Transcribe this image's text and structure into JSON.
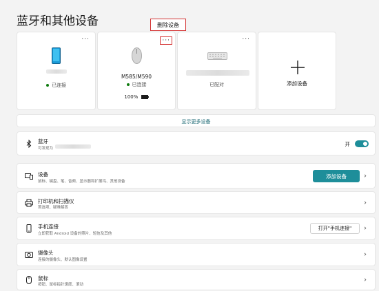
{
  "page": {
    "title": "蓝牙和其他设备"
  },
  "tooltip": {
    "label": "删除设备"
  },
  "cards": [
    {
      "name": "",
      "status": "已连接",
      "battery": ""
    },
    {
      "name": "M585/M590",
      "status": "已连接",
      "battery": "100%"
    },
    {
      "name": "",
      "status": "已配对",
      "battery": ""
    },
    {
      "name": "添加设备",
      "status": "",
      "battery": ""
    }
  ],
  "show_more": {
    "label": "显示更多设备"
  },
  "bluetooth": {
    "title": "蓝牙",
    "subtitle": "可发现为",
    "toggle_label": "开",
    "toggle_on": true
  },
  "rows": {
    "devices": {
      "title": "设备",
      "subtitle": "鼠标、键盘、笔、音频、显示器和扩展坞、其他设备",
      "button": "添加设备"
    },
    "printers": {
      "title": "打印机和扫描仪",
      "subtitle": "首选项、疑难解答"
    },
    "phone": {
      "title": "手机连接",
      "subtitle": "立即获取 Android 设备的照片、短信及其他",
      "button": "打开\"手机连接\""
    },
    "camera": {
      "title": "摄像头",
      "subtitle": "连接的摄像头、默认图像设置"
    },
    "mouse": {
      "title": "鼠标",
      "subtitle": "按钮、鼠标指针速度、滚动"
    }
  },
  "colors": {
    "accent": "#1e8e9a",
    "connected": "#0f7b0f",
    "highlight": "#d32f2f"
  }
}
